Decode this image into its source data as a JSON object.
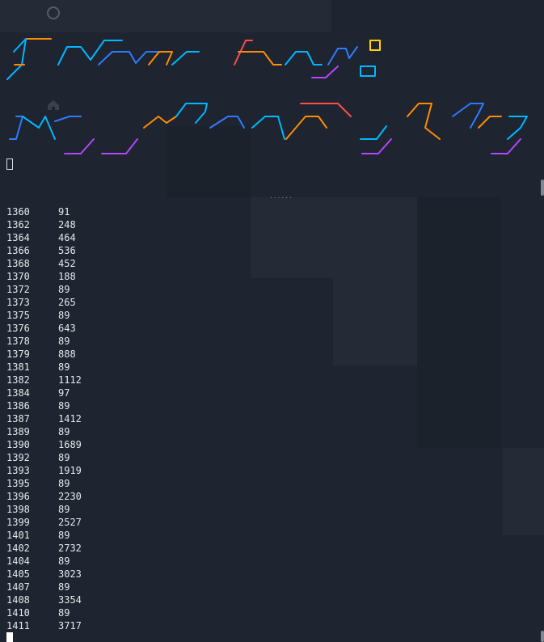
{
  "table": {
    "rows": [
      [
        "1360",
        "91"
      ],
      [
        "1362",
        "248"
      ],
      [
        "1364",
        "464"
      ],
      [
        "1366",
        "536"
      ],
      [
        "1368",
        "452"
      ],
      [
        "1370",
        "188"
      ],
      [
        "1372",
        "89"
      ],
      [
        "1373",
        "265"
      ],
      [
        "1375",
        "89"
      ],
      [
        "1376",
        "643"
      ],
      [
        "1378",
        "89"
      ],
      [
        "1379",
        "888"
      ],
      [
        "1381",
        "89"
      ],
      [
        "1382",
        "1112"
      ],
      [
        "1384",
        "97"
      ],
      [
        "1386",
        "89"
      ],
      [
        "1387",
        "1412"
      ],
      [
        "1389",
        "89"
      ],
      [
        "1390",
        "1689"
      ],
      [
        "1392",
        "89"
      ],
      [
        "1393",
        "1919"
      ],
      [
        "1395",
        "89"
      ],
      [
        "1396",
        "2230"
      ],
      [
        "1398",
        "89"
      ],
      [
        "1399",
        "2527"
      ],
      [
        "1401",
        "89"
      ],
      [
        "1402",
        "2732"
      ],
      [
        "1404",
        "89"
      ],
      [
        "1405",
        "3023"
      ],
      [
        "1407",
        "89"
      ],
      [
        "1408",
        "3354"
      ],
      [
        "1410",
        "89"
      ],
      [
        "1411",
        "3717"
      ]
    ]
  },
  "decor": {
    "banner_colors": [
      "#ff4d4d",
      "#ff8c00",
      "#00b7ff",
      "#2f7bff",
      "#b146ff",
      "#ffd400"
    ],
    "dots": "......"
  },
  "icons": {
    "top": "circle-icon",
    "middle": "home-icon"
  }
}
